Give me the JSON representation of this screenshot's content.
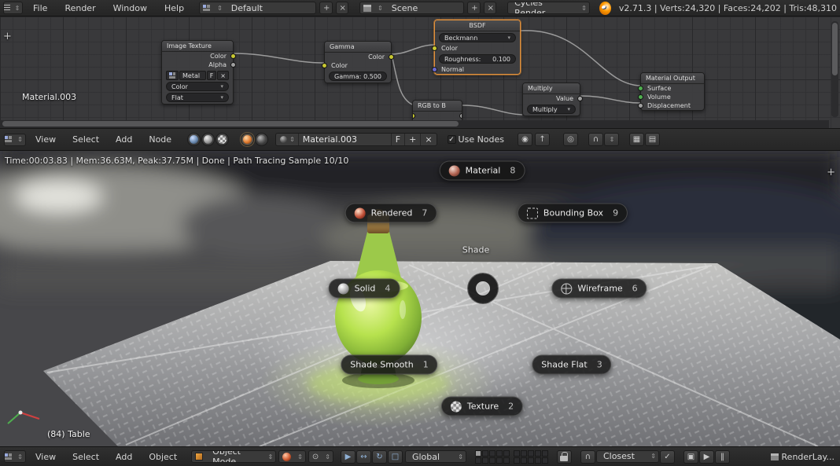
{
  "colors": {
    "accent_orange": "#e0903c",
    "bottle_green": "#9fcc3f",
    "header_bg": "#2a2a2a"
  },
  "icons": {
    "updown": "⇕",
    "down": "▾",
    "plus": "+",
    "close": "×",
    "check": "✓",
    "pin": "◉",
    "up": "↑",
    "magnet": "∩",
    "rotate": "↻",
    "square": "□",
    "arrow": "▶",
    "move": "↔",
    "pivot": "⊙",
    "render": "▣",
    "pause": "‖",
    "circle": "◎",
    "grid": "▦",
    "sheet": "▤"
  },
  "topbar": {
    "menus": [
      {
        "label": "File"
      },
      {
        "label": "Render"
      },
      {
        "label": "Window"
      },
      {
        "label": "Help"
      }
    ],
    "layout": {
      "value": "Default"
    },
    "scene": {
      "value": "Scene"
    },
    "engine": {
      "value": "Cycles Render"
    },
    "stats": "v2.71.3 | Verts:24,320 | Faces:24,202 | Tris:48,310"
  },
  "node_editor": {
    "breadcrumb": "Material.003",
    "nodes": {
      "image_texture": {
        "title": "Image Texture",
        "out_color": "Color",
        "out_alpha": "Alpha",
        "datablock": "Metal",
        "f": "F",
        "colorspace": "Color",
        "projection": "Flat"
      },
      "gamma": {
        "title": "Gamma",
        "out": "Color",
        "in": "Color",
        "gamma_label": "Gamma:",
        "gamma_value": "0.500"
      },
      "bsdf": {
        "title": "BSDF",
        "distribution": "Beckmann",
        "in_color": "Color",
        "rough_label": "Roughness:",
        "rough_value": "0.100",
        "in_normal": "Normal"
      },
      "rgb_to_b": {
        "title": "RGB to B"
      },
      "multiply": {
        "title": "Multiply",
        "out": "Value",
        "operation": "Multiply"
      },
      "material_output": {
        "title": "Material Output",
        "in_surface": "Surface",
        "in_volume": "Volume",
        "in_displacement": "Displacement"
      }
    },
    "header": {
      "menus": [
        {
          "label": "View"
        },
        {
          "label": "Select"
        },
        {
          "label": "Add"
        },
        {
          "label": "Node"
        }
      ],
      "material_name": "Material.003",
      "f": "F",
      "use_nodes": "Use Nodes"
    }
  },
  "viewport": {
    "render_status": "Time:00:03.83 | Mem:36.63M, Peak:37.75M | Done | Path Tracing Sample 10/10",
    "object_info": "(84) Table",
    "pie": {
      "center_label": "Shade",
      "items": [
        {
          "label": "Material",
          "key": "8"
        },
        {
          "label": "Rendered",
          "key": "7"
        },
        {
          "label": "Bounding Box",
          "key": "9"
        },
        {
          "label": "Solid",
          "key": "4"
        },
        {
          "label": "Wireframe",
          "key": "6"
        },
        {
          "label": "Shade Smooth",
          "key": "1"
        },
        {
          "label": "Shade Flat",
          "key": "3"
        },
        {
          "label": "Texture",
          "key": "2"
        }
      ]
    }
  },
  "viewport_header": {
    "menus": [
      {
        "label": "View"
      },
      {
        "label": "Select"
      },
      {
        "label": "Add"
      },
      {
        "label": "Object"
      }
    ],
    "mode": "Object Mode",
    "orientation": "Global",
    "snap_target": "Closest",
    "render_layer": "RenderLay..."
  }
}
